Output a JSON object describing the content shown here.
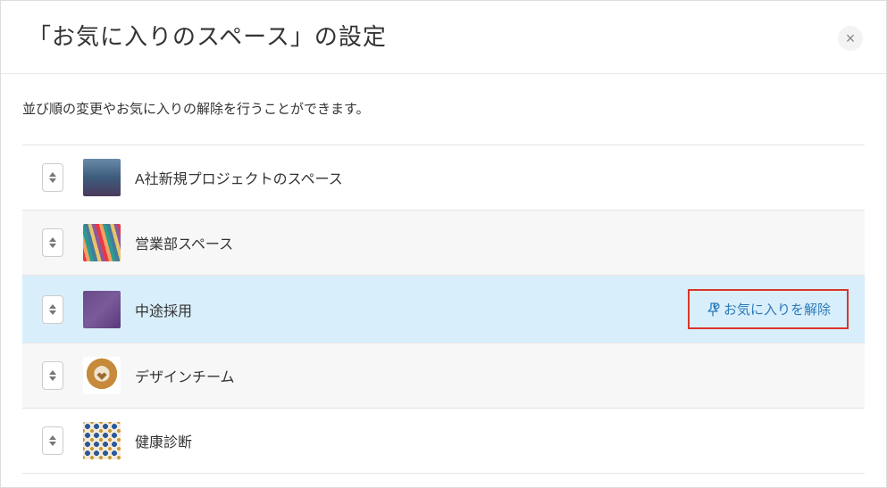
{
  "dialog": {
    "title": "「お気に入りのスペース」の設定",
    "description": "並び順の変更やお気に入りの解除を行うことができます。"
  },
  "items": [
    {
      "label": "A社新規プロジェクトのスペース",
      "highlighted": false,
      "alt": false
    },
    {
      "label": "営業部スペース",
      "highlighted": false,
      "alt": true
    },
    {
      "label": "中途採用",
      "highlighted": true,
      "alt": false,
      "removeLabel": "お気に入りを解除"
    },
    {
      "label": "デザインチーム",
      "highlighted": false,
      "alt": true
    },
    {
      "label": "健康診断",
      "highlighted": false,
      "alt": false
    }
  ]
}
